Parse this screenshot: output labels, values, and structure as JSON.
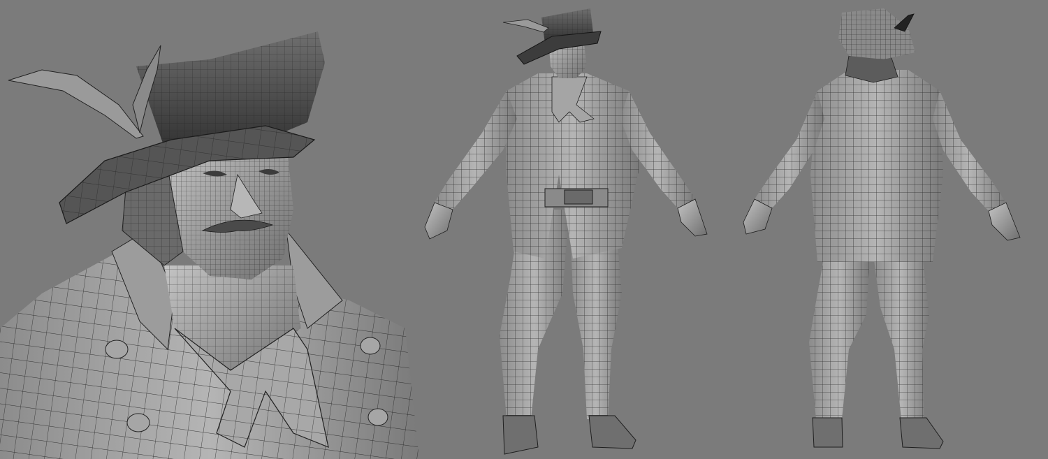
{
  "canvas": {
    "background": "#7b7b7b"
  },
  "palette": {
    "surface_light": "#b9b9b9",
    "surface_mid": "#8f8f8f",
    "surface_dark": "#3a3a3a",
    "wire": "#1e1e1e"
  },
  "views": [
    {
      "id": "closeup",
      "description_shown": "none"
    },
    {
      "id": "front",
      "description_shown": "none"
    },
    {
      "id": "back",
      "description_shown": "none"
    }
  ]
}
